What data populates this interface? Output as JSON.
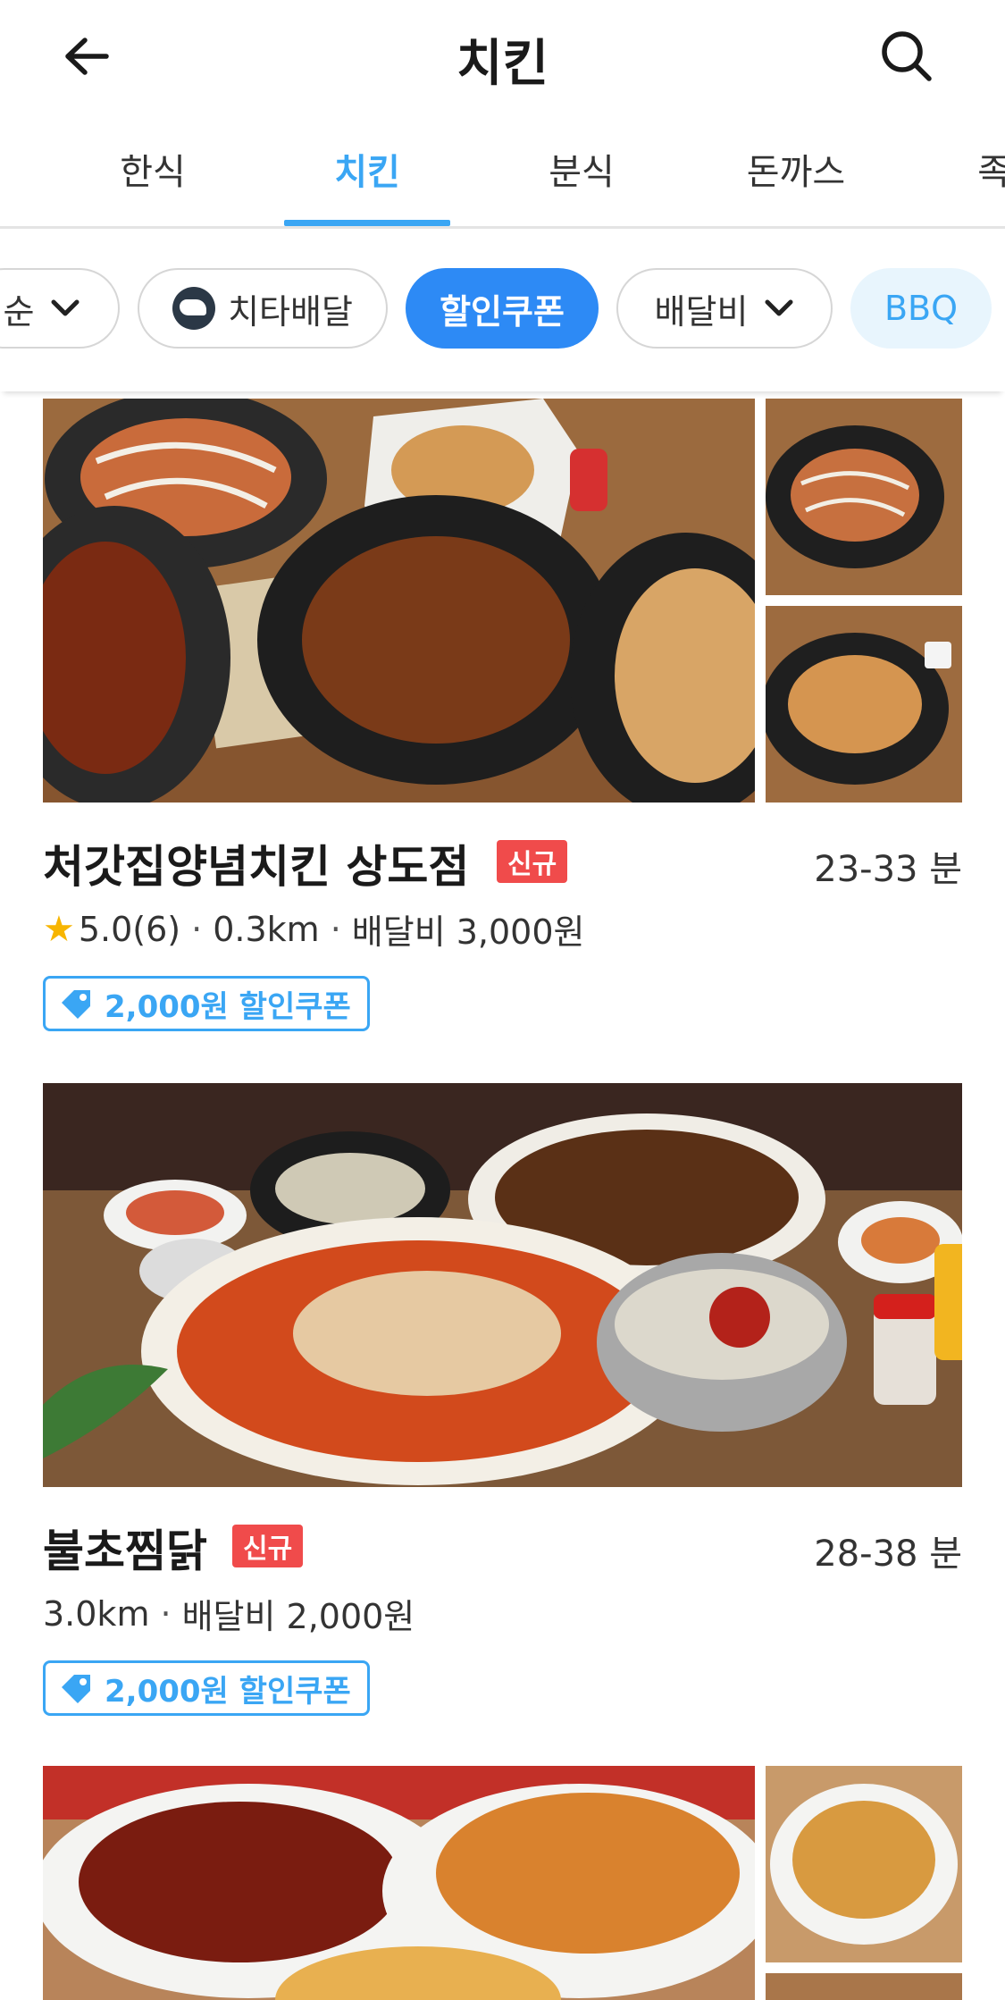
{
  "header": {
    "title": "치킨",
    "back_icon": "arrow-left-icon",
    "search_icon": "search-icon"
  },
  "tabs": [
    {
      "label": "한식",
      "active": false
    },
    {
      "label": "치킨",
      "active": true
    },
    {
      "label": "분식",
      "active": false
    },
    {
      "label": "돈까스",
      "active": false
    },
    {
      "label": "족발",
      "active": false
    }
  ],
  "filters": {
    "sort_label": "순",
    "cheetah_label": "치타배달",
    "coupon_label": "할인쿠폰",
    "delivery_fee_label": "배달비",
    "brand_label": "BBQ"
  },
  "restaurants": [
    {
      "name": "처갓집양념치킨 상도점",
      "badge": "신규",
      "time": "23-33 분",
      "rating": "5.0(6)",
      "distance": "0.3km",
      "delivery_fee": "배달비 3,000원",
      "coupon": "2,000원 할인쿠폰"
    },
    {
      "name": "불초찜닭",
      "badge": "신규",
      "time": "28-38 분",
      "distance": "3.0km",
      "delivery_fee": "배달비 2,000원",
      "coupon": "2,000원 할인쿠폰"
    }
  ],
  "colors": {
    "accent": "#3aa6f4",
    "primary_chip": "#2d8af5",
    "new_badge": "#f04b4b",
    "star": "#f7b500"
  }
}
